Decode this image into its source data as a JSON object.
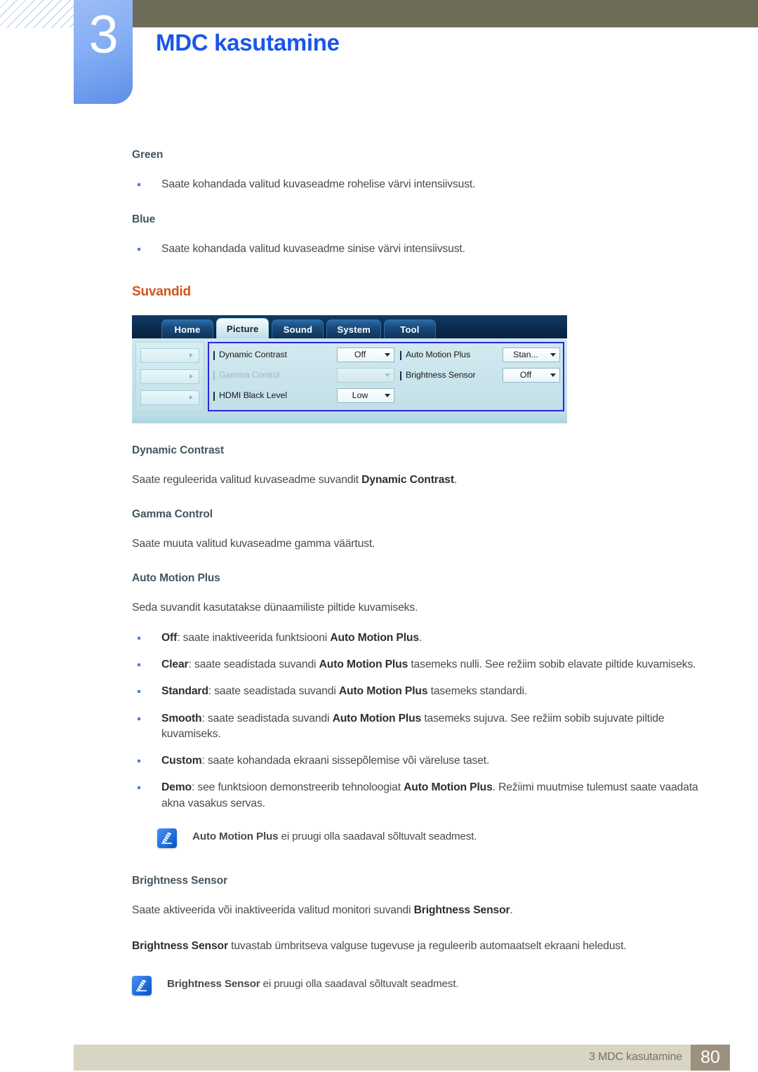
{
  "header": {
    "chapter_number": "3",
    "chapter_title": "MDC kasutamine"
  },
  "sections": {
    "green_heading": "Green",
    "green_bullet": "Saate kohandada valitud kuvaseadme rohelise värvi intensiivsust.",
    "blue_heading": "Blue",
    "blue_bullet": "Saate kohandada valitud kuvaseadme sinise värvi intensiivsust.",
    "suvandid_heading": "Suvandid",
    "dynamic_contrast_heading": "Dynamic Contrast",
    "dynamic_contrast_body_pre": "Saate reguleerida valitud kuvaseadme suvandit ",
    "dynamic_contrast_body_bold": "Dynamic Contrast",
    "dynamic_contrast_body_post": ".",
    "gamma_control_heading": "Gamma Control",
    "gamma_control_body": "Saate muuta valitud kuvaseadme gamma väärtust.",
    "auto_motion_plus_heading": "Auto Motion Plus",
    "auto_motion_plus_body": "Seda suvandit kasutatakse dünaamiliste piltide kuvamiseks.",
    "brightness_sensor_heading": "Brightness Sensor",
    "brightness_sensor_body1_pre": "Saate aktiveerida või inaktiveerida valitud monitori suvandi ",
    "brightness_sensor_body1_bold": "Brightness Sensor",
    "brightness_sensor_body1_post": ".",
    "brightness_sensor_body2_bold": "Brightness Sensor",
    "brightness_sensor_body2_post": " tuvastab ümbritseva valguse tugevuse ja reguleerib automaatselt ekraani heledust."
  },
  "amp_bullets": [
    {
      "term": "Off",
      "pre": ": saate inaktiveerida funktsiooni ",
      "bold": "Auto Motion Plus",
      "post": "."
    },
    {
      "term": "Clear",
      "pre": ": saate seadistada suvandi ",
      "bold": "Auto Motion Plus",
      "post": " tasemeks nulli. See režiim sobib elavate piltide kuvamiseks."
    },
    {
      "term": "Standard",
      "pre": ": saate seadistada suvandi ",
      "bold": "Auto Motion Plus",
      "post": " tasemeks standardi."
    },
    {
      "term": "Smooth",
      "pre": ": saate seadistada suvandi ",
      "bold": "Auto Motion Plus",
      "post": " tasemeks sujuva. See režiim sobib sujuvate piltide kuvamiseks."
    },
    {
      "term": "Custom",
      "pre": ": saate kohandada ekraani sissepõlemise või väreluse taset.",
      "bold": "",
      "post": ""
    },
    {
      "term": "Demo",
      "pre": ": see funktsioon demonstreerib tehnoloogiat ",
      "bold": "Auto Motion Plus",
      "post": ". Režiimi muutmise tulemust saate vaadata akna vasakus servas."
    }
  ],
  "notes": [
    {
      "bold": "Auto Motion Plus",
      "text": " ei pruugi olla saadaval sõltuvalt seadmest.",
      "icon": "note-pen-icon"
    },
    {
      "bold": "Brightness Sensor",
      "text": " ei pruugi olla saadaval sõltuvalt seadmest.",
      "icon": "note-pen-icon"
    }
  ],
  "mdc": {
    "tabs": [
      {
        "label": "Home",
        "active": false
      },
      {
        "label": "Picture",
        "active": true
      },
      {
        "label": "Sound",
        "active": false
      },
      {
        "label": "System",
        "active": false
      },
      {
        "label": "Tool",
        "active": false
      }
    ],
    "left_stubs": [
      "",
      "",
      ""
    ],
    "controls_left": [
      {
        "label": "Dynamic Contrast",
        "value": "Off",
        "disabled": false
      },
      {
        "label": "Gamma Control",
        "value": "",
        "disabled": true
      },
      {
        "label": "HDMI Black Level",
        "value": "Low",
        "disabled": false
      }
    ],
    "controls_right": [
      {
        "label": "Auto Motion Plus",
        "value": "Stan...",
        "disabled": false
      },
      {
        "label": "Brightness Sensor",
        "value": "Off",
        "disabled": false
      }
    ]
  },
  "footer": {
    "text": "3 MDC kasutamine",
    "page": "80"
  },
  "colors": {
    "olive_bar": "#6d6c56",
    "chapter_blue": "#84aef4",
    "title_blue": "#1a56e8",
    "orange_heading": "#d4531e",
    "subheading": "#44555f",
    "bullet_marker": "#4a7fd6",
    "footer_bar": "#d9d5c3",
    "footer_page_box": "#9c907f",
    "mdc_panel_border": "#2727e0"
  }
}
